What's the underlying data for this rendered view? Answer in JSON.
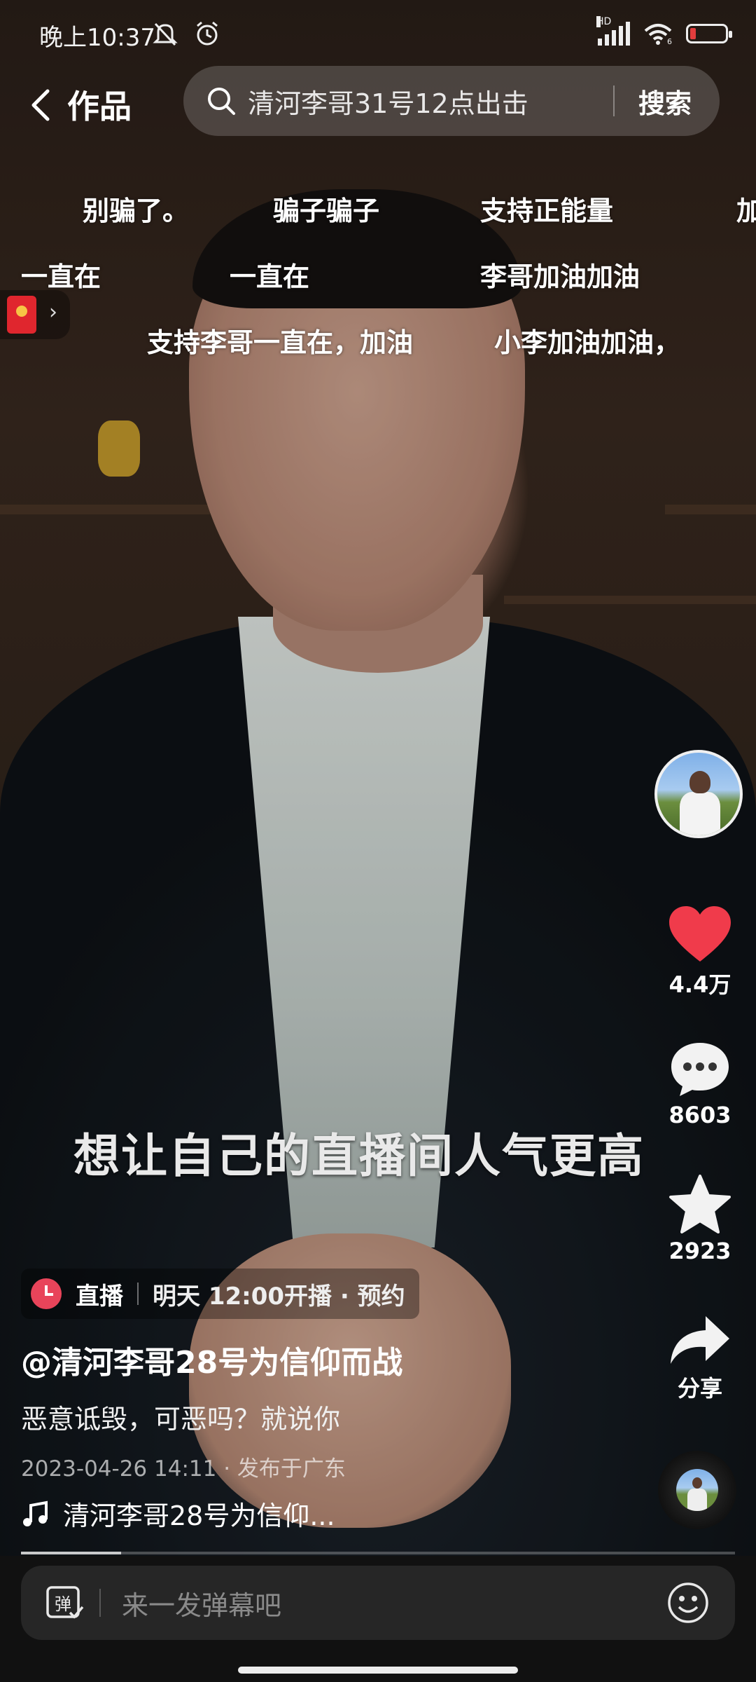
{
  "status_bar": {
    "time": "晚上10:37",
    "network_label": "HD",
    "signal_sub": "6"
  },
  "top_nav": {
    "title": "作品",
    "search_text": "清河李哥31号12点出击",
    "search_button": "搜索"
  },
  "danmaku": [
    "别骗了。",
    "骗子骗子",
    "支持正能量",
    "加",
    "一直在",
    "一直在",
    "李哥加油加油",
    "支持李哥一直在，加油",
    "小李加油加油，"
  ],
  "caption": "想让自己的直播间人气更高",
  "actions": {
    "likes": "4.4万",
    "comments": "8603",
    "favorites": "2923",
    "share": "分享"
  },
  "live": {
    "label": "直播",
    "schedule": "明天 12:00开播 · 预约"
  },
  "author": "@清河李哥28号为信仰而战",
  "description": "恶意诋毁，可恶吗？就说你",
  "meta": "2023-04-26 14:11 · 发布于广东",
  "music": "清河李哥28号为信仰...",
  "progress": 0.14,
  "bottom": {
    "placeholder": "来一发弹幕吧",
    "danmaku_toggle_glyph": "弹"
  },
  "colors": {
    "like_red": "#f03b4b",
    "live_clock": "#e8445a",
    "red_packet": "#e0262e"
  }
}
